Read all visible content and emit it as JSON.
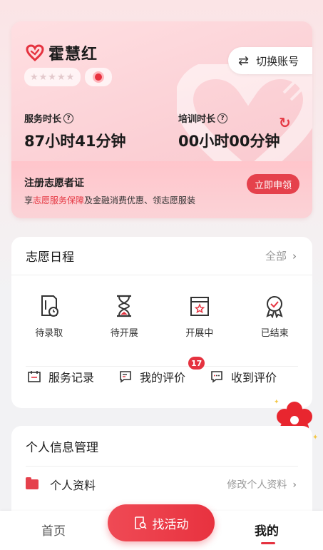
{
  "profile": {
    "name": "霍慧红",
    "stars": "★★★★★",
    "switch_account": "切换账号",
    "service_hours_label": "服务时长",
    "service_hours_value": "87小时41分钟",
    "training_hours_label": "培训时长",
    "training_hours_value": "00小时00分钟",
    "question_mark": "?",
    "register_title": "注册志愿者证",
    "register_desc_prefix": "享",
    "register_desc_highlight": "志愿服务保障",
    "register_desc_suffix": "及金融消费优惠、领志愿服装",
    "apply_label": "立即申领"
  },
  "schedule": {
    "title": "志愿日程",
    "all_label": "全部",
    "statuses": [
      {
        "label": "待录取",
        "icon": "document-clock-icon"
      },
      {
        "label": "待开展",
        "icon": "hourglass-icon"
      },
      {
        "label": "开展中",
        "icon": "calendar-star-icon"
      },
      {
        "label": "已结束",
        "icon": "award-icon"
      }
    ],
    "links": [
      {
        "label": "服务记录",
        "icon": "record-icon"
      },
      {
        "label": "我的评价",
        "icon": "my-review-icon",
        "badge": "17"
      },
      {
        "label": "收到评价",
        "icon": "chat-icon"
      }
    ]
  },
  "info": {
    "title": "个人信息管理",
    "profile_label": "个人资料",
    "edit_label": "修改个人资料"
  },
  "nav": {
    "home": "首页",
    "find": "找活动",
    "mine": "我的"
  },
  "colors": {
    "accent": "#e5323f",
    "card_pink": "#fbd0d5"
  }
}
